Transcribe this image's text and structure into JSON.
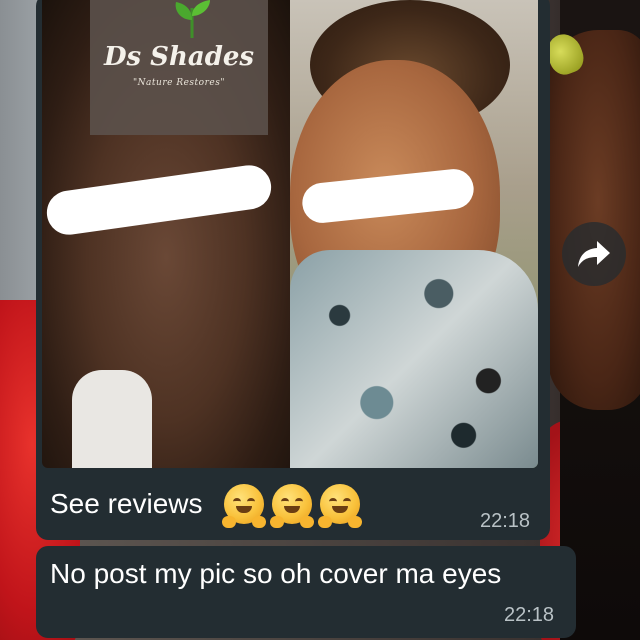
{
  "photo": {
    "logo_title": "Ds Shades",
    "logo_tagline": "\"Nature Restores\""
  },
  "messages": [
    {
      "text": "See reviews",
      "emoji_count": 3,
      "emoji": "hugging-face",
      "time": "22:18"
    },
    {
      "text": "No post my pic so oh cover ma eyes",
      "time": "22:18"
    }
  ],
  "colors": {
    "bubble": "#232d32",
    "timestamp": "#b9c2c6",
    "text": "#ffffff"
  },
  "icons": {
    "forward": "forward-arrow-icon",
    "logo_leaf": "leaf-icon"
  }
}
